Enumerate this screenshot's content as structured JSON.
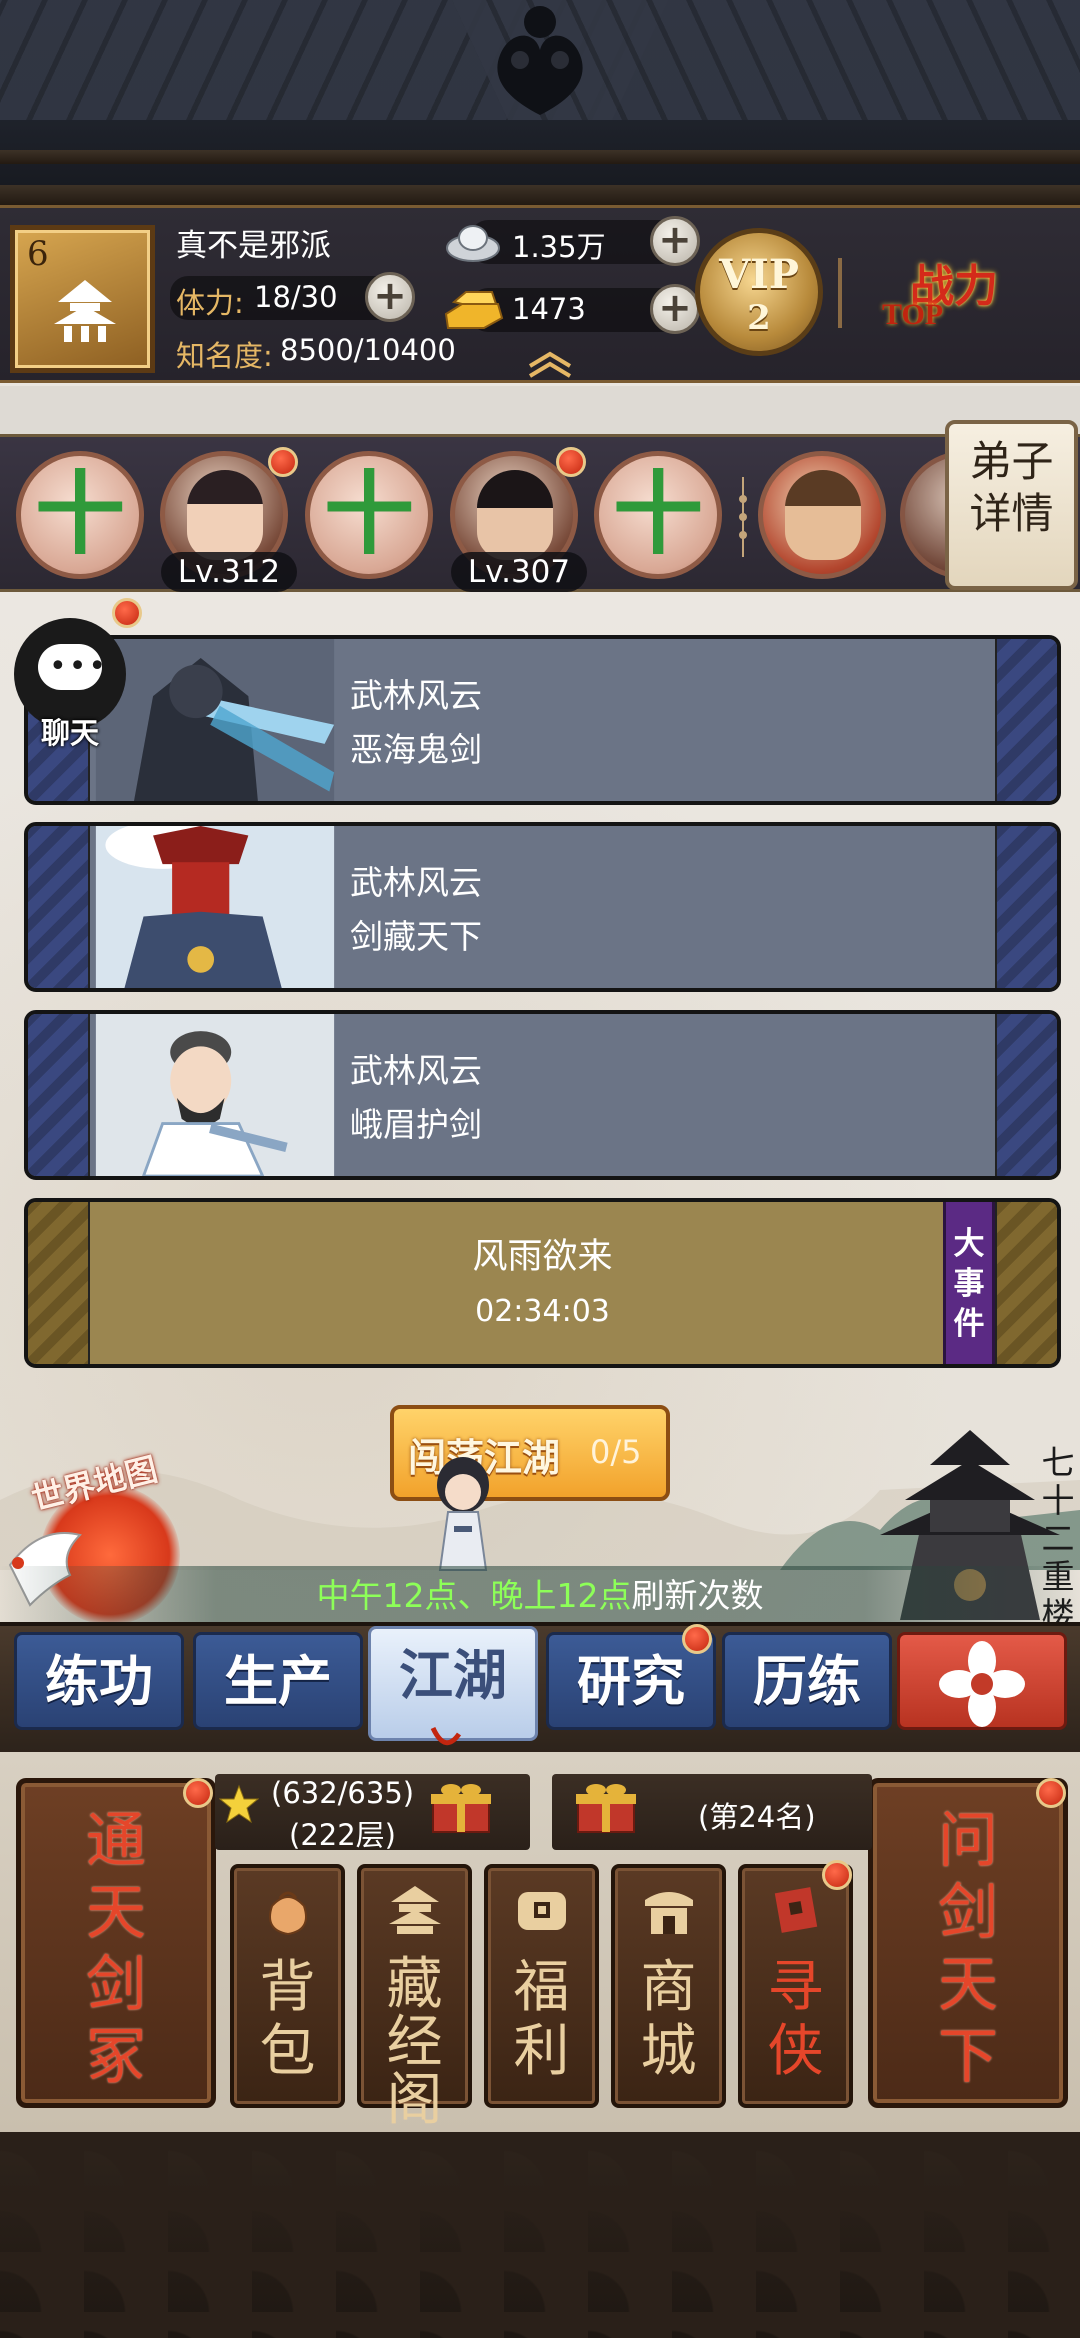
{
  "header": {
    "level": "6",
    "player_name": "真不是邪派",
    "stamina_label": "体力:",
    "stamina_value": "18/30",
    "fame_label": "知名度:",
    "fame_value": "8500/10400",
    "silver": "1.35万",
    "gold": "1473",
    "vip_label": "VIP",
    "vip_level": "2",
    "power_title": "战力",
    "power_sub": "TOP"
  },
  "disciples": {
    "slots": [
      {
        "type": "add",
        "icon": "plus-icon"
      },
      {
        "type": "avatar",
        "level": "Lv.312"
      },
      {
        "type": "add",
        "icon": "plus-icon"
      },
      {
        "type": "avatar",
        "level": "Lv.307"
      },
      {
        "type": "add",
        "icon": "plus-icon"
      },
      {
        "type": "avatar",
        "level": ""
      }
    ],
    "detail_button": [
      "弟子",
      "详情"
    ]
  },
  "chat": {
    "label": "聊天",
    "icon": "chat-bubble-icon"
  },
  "activities": [
    {
      "title": "武林风云",
      "subtitle": "恶海鬼剑"
    },
    {
      "title": "武林风云",
      "subtitle": "剑藏天下"
    },
    {
      "title": "武林风云",
      "subtitle": "峨眉护剑"
    }
  ],
  "event": {
    "title": "风雨欲来",
    "timer": "02:34:03",
    "tag": "大事件"
  },
  "map": {
    "world_map_label": "世界地图",
    "quest_label": "闯荡江湖",
    "quest_count": "0/5",
    "tower_label": "七十二重楼",
    "refresh_highlight": "中午12点、晚上12点",
    "refresh_text": "刷新次数"
  },
  "tabs": [
    {
      "label": "练功",
      "active": false
    },
    {
      "label": "生产",
      "active": false
    },
    {
      "label": "江湖",
      "active": true
    },
    {
      "label": "研究",
      "active": false
    },
    {
      "label": "历练",
      "active": false
    },
    {
      "label": "",
      "icon": "flower-emblem-icon"
    }
  ],
  "bottom": {
    "left_plaque": "通天剑冢",
    "right_plaque": "问剑天下",
    "tower_progress": "(632/635)",
    "tower_floor": "(222层)",
    "rank": "(第24名)",
    "menu": [
      {
        "label": "背包",
        "icon": "bag-icon"
      },
      {
        "label": "藏经阁",
        "icon": "pavilion-icon"
      },
      {
        "label": "福利",
        "icon": "coin-icon"
      },
      {
        "label": "商城",
        "icon": "shop-icon"
      },
      {
        "label": "寻侠",
        "icon": "scroll-icon"
      }
    ]
  },
  "colors": {
    "accent_gold": "#e5b765",
    "notify_red": "#c3260f",
    "refresh_green": "#8dff58"
  }
}
